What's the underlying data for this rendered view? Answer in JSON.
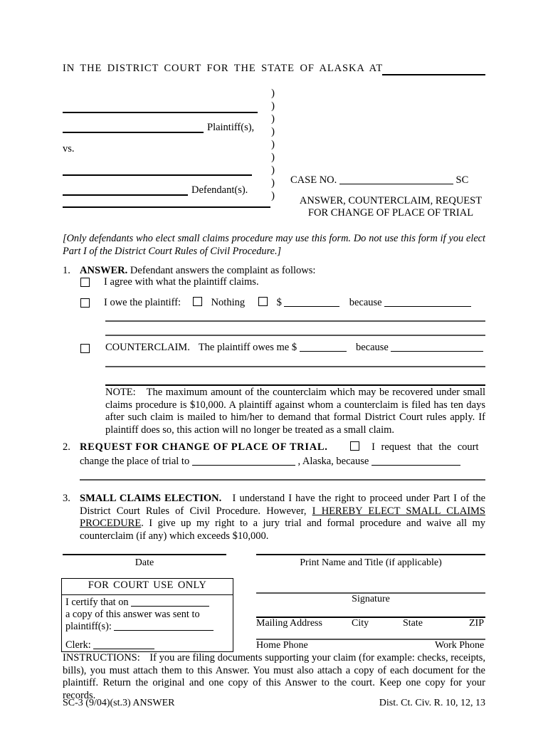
{
  "header": {
    "court_title": "IN THE DISTRICT COURT FOR THE STATE OF ALASKA AT"
  },
  "caption": {
    "plaintiff_label": "Plaintiff(s),",
    "vs_label": "vs.",
    "defendant_label": "Defendant(s).",
    "paren": ")",
    "case_no_label": "CASE NO.",
    "case_no_suffix": "SC",
    "doc_title_line1": "ANSWER, COUNTERCLAIM, REQUEST",
    "doc_title_line2": "FOR CHANGE OF PLACE OF TRIAL"
  },
  "intro": {
    "italic_note": "[Only defendants who elect small claims procedure may use this form.  Do not use this form if you elect Part I of the District Court Rules of Civil Procedure.]"
  },
  "section1": {
    "number": "1.",
    "heading": "ANSWER.",
    "lead": "Defendant answers the complaint as follows:",
    "option_agree": "I agree with what the plaintiff claims.",
    "owe_label": "I owe the plaintiff:",
    "owe_nothing": "Nothing",
    "owe_dollar": "$",
    "because": "because",
    "counterclaim_label": "COUNTERCLAIM.",
    "counterclaim_text": "The plaintiff owes me $",
    "counterclaim_because": "because",
    "note_label": "NOTE:",
    "note_text": "The maximum amount of the counterclaim which may be recovered under small claims procedure is $10,000.  A plaintiff against whom a counterclaim is filed has ten days after such claim is mailed to him/her to demand that formal District Court rules apply.  If plaintiff does so, this action will no longer be treated as a small claim."
  },
  "section2": {
    "number": "2.",
    "heading": "REQUEST FOR CHANGE OF PLACE OF TRIAL.",
    "request_text": "I request that the court",
    "line2_pre": "change the place of trial to",
    "line2_mid": ", Alaska, because"
  },
  "section3": {
    "number": "3.",
    "heading": "SMALL CLAIMS ELECTION.",
    "text_part1": "I understand I have the right to proceed under Part I of the District Court Rules of Civil Procedure.  However, ",
    "text_underlined": "I HEREBY ELECT SMALL CLAIMS PROCEDURE",
    "text_part2": ".  I give up my right to a jury trial and formal procedure and waive all my counterclaim (if any) which exceeds $10,000."
  },
  "signature_block": {
    "date_label": "Date",
    "print_name_label": "Print Name and Title (if applicable)",
    "signature_label": "Signature",
    "mailing_address_label": "Mailing Address",
    "city_label": "City",
    "state_label": "State",
    "zip_label": "ZIP",
    "home_phone_label": "Home Phone",
    "work_phone_label": "Work Phone"
  },
  "court_use_box": {
    "title": "FOR  COURT  USE  ONLY",
    "line1": "I certify that on",
    "line2": "a copy  of  this  answer  was  sent  to",
    "line3": "plaintiff(s):",
    "clerk_label": "Clerk:"
  },
  "instructions": {
    "label": "INSTRUCTIONS:",
    "text": "If you are filing documents supporting your claim (for example: checks, receipts, bills), you must attach them to this Answer.  You must also attach a copy of each document for the plaintiff.  Return the original and one copy of this Answer to the court.  Keep one copy for your records."
  },
  "footer": {
    "left": "SC-3 (9/04)(st.3) ANSWER",
    "right": "Dist. Ct. Civ. R. 10, 12, 13"
  }
}
